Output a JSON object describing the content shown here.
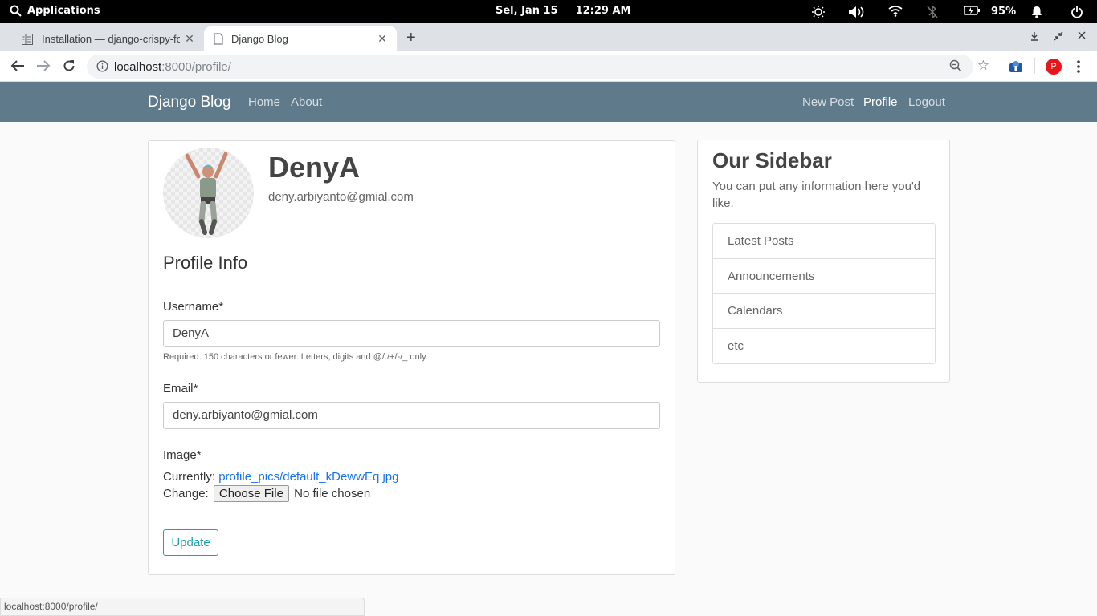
{
  "os": {
    "apps_label": "Applications",
    "date": "Sel, Jan 15",
    "time": "12:29 AM",
    "battery": "95%"
  },
  "browser": {
    "tabs": [
      {
        "title": "Installation — django-crispy-forms"
      },
      {
        "title": "Django Blog"
      }
    ],
    "url_host": "localhost",
    "url_rest": ":8000/profile/",
    "profile_initial": "P",
    "status_url": "localhost:8000/profile/"
  },
  "navbar": {
    "brand": "Django Blog",
    "left": [
      "Home",
      "About"
    ],
    "right": [
      "New Post",
      "Profile",
      "Logout"
    ],
    "bg_color": "#5f7a8b"
  },
  "profile": {
    "username": "DenyA",
    "email": "deny.arbiyanto@gmial.com",
    "legend": "Profile Info",
    "username_label": "Username*",
    "username_value": "DenyA",
    "username_help": "Required. 150 characters or fewer. Letters, digits and @/./+/-/_ only.",
    "email_label": "Email*",
    "email_value": "deny.arbiyanto@gmial.com",
    "image_label": "Image*",
    "currently_label": "Currently:",
    "current_file": "profile_pics/default_kDewwEq.jpg",
    "change_label": "Change:",
    "choose_file": "Choose File",
    "no_file": "No file chosen",
    "submit": "Update",
    "accent": "#17a2b8"
  },
  "sidebar": {
    "title": "Our Sidebar",
    "description": "You can put any information here you'd like.",
    "items": [
      "Latest Posts",
      "Announcements",
      "Calendars",
      "etc"
    ]
  }
}
